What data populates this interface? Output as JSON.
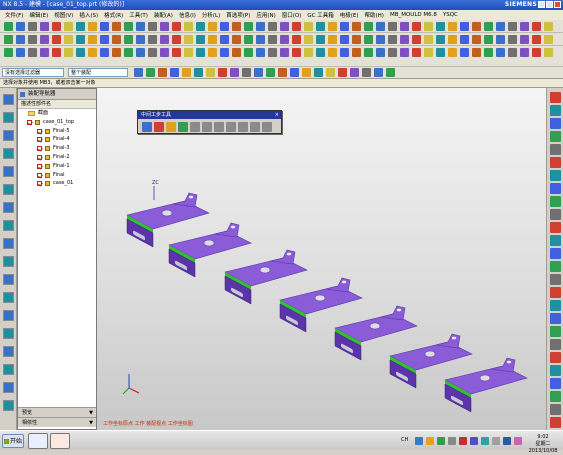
{
  "window": {
    "title": "NX 8.5 - 建模 - [case_01_top.prt (修改的)]",
    "brand": "SIEMENS"
  },
  "menu": [
    "文件(F)",
    "编辑(E)",
    "视图(V)",
    "插入(S)",
    "格式(R)",
    "工具(T)",
    "装配(A)",
    "信息(I)",
    "分析(L)",
    "首选项(P)",
    "应用(N)",
    "窗口(O)",
    "GC 工具箱",
    "电极(E)",
    "帮助(H)",
    "MB_MOULD M6.8",
    "YSQC"
  ],
  "filterbar": {
    "filter_value": "没有选择过滤器",
    "scope_value": "整个装配"
  },
  "statusbar": {
    "prompt": "选择对象并使用 MB3，或者双击某一对象"
  },
  "nav": {
    "title": "装配导航器",
    "column": "描述性部件名",
    "rows": [
      {
        "label": "截面",
        "kind": "folder",
        "indent": 0
      },
      {
        "label": "case_01_top",
        "kind": "assembly",
        "indent": 0
      },
      {
        "label": "Final-5",
        "kind": "part",
        "indent": 1
      },
      {
        "label": "Final-4",
        "kind": "part",
        "indent": 1
      },
      {
        "label": "Final-3",
        "kind": "part",
        "indent": 1
      },
      {
        "label": "Final-2",
        "kind": "part",
        "indent": 1
      },
      {
        "label": "Final-1",
        "kind": "part",
        "indent": 1
      },
      {
        "label": "Final",
        "kind": "part",
        "indent": 1
      },
      {
        "label": "case_01",
        "kind": "part",
        "indent": 1
      }
    ],
    "footer": [
      {
        "label": "预览"
      },
      {
        "label": "相依性"
      }
    ]
  },
  "floating_toolbar": {
    "title": "中间工步工具"
  },
  "viewport": {
    "axis_label": "ZC",
    "part_color": "#8a5cd8",
    "part_dark": "#5a34a8",
    "edge_color": "#30c030",
    "copies": 7
  },
  "cue": "工作坐标原点   工作 装配视点   工作坐标图",
  "taskbar": {
    "start": "开始",
    "lang": "CH",
    "time": "9:02",
    "weekday": "星期二",
    "date": "2013/10/08"
  }
}
